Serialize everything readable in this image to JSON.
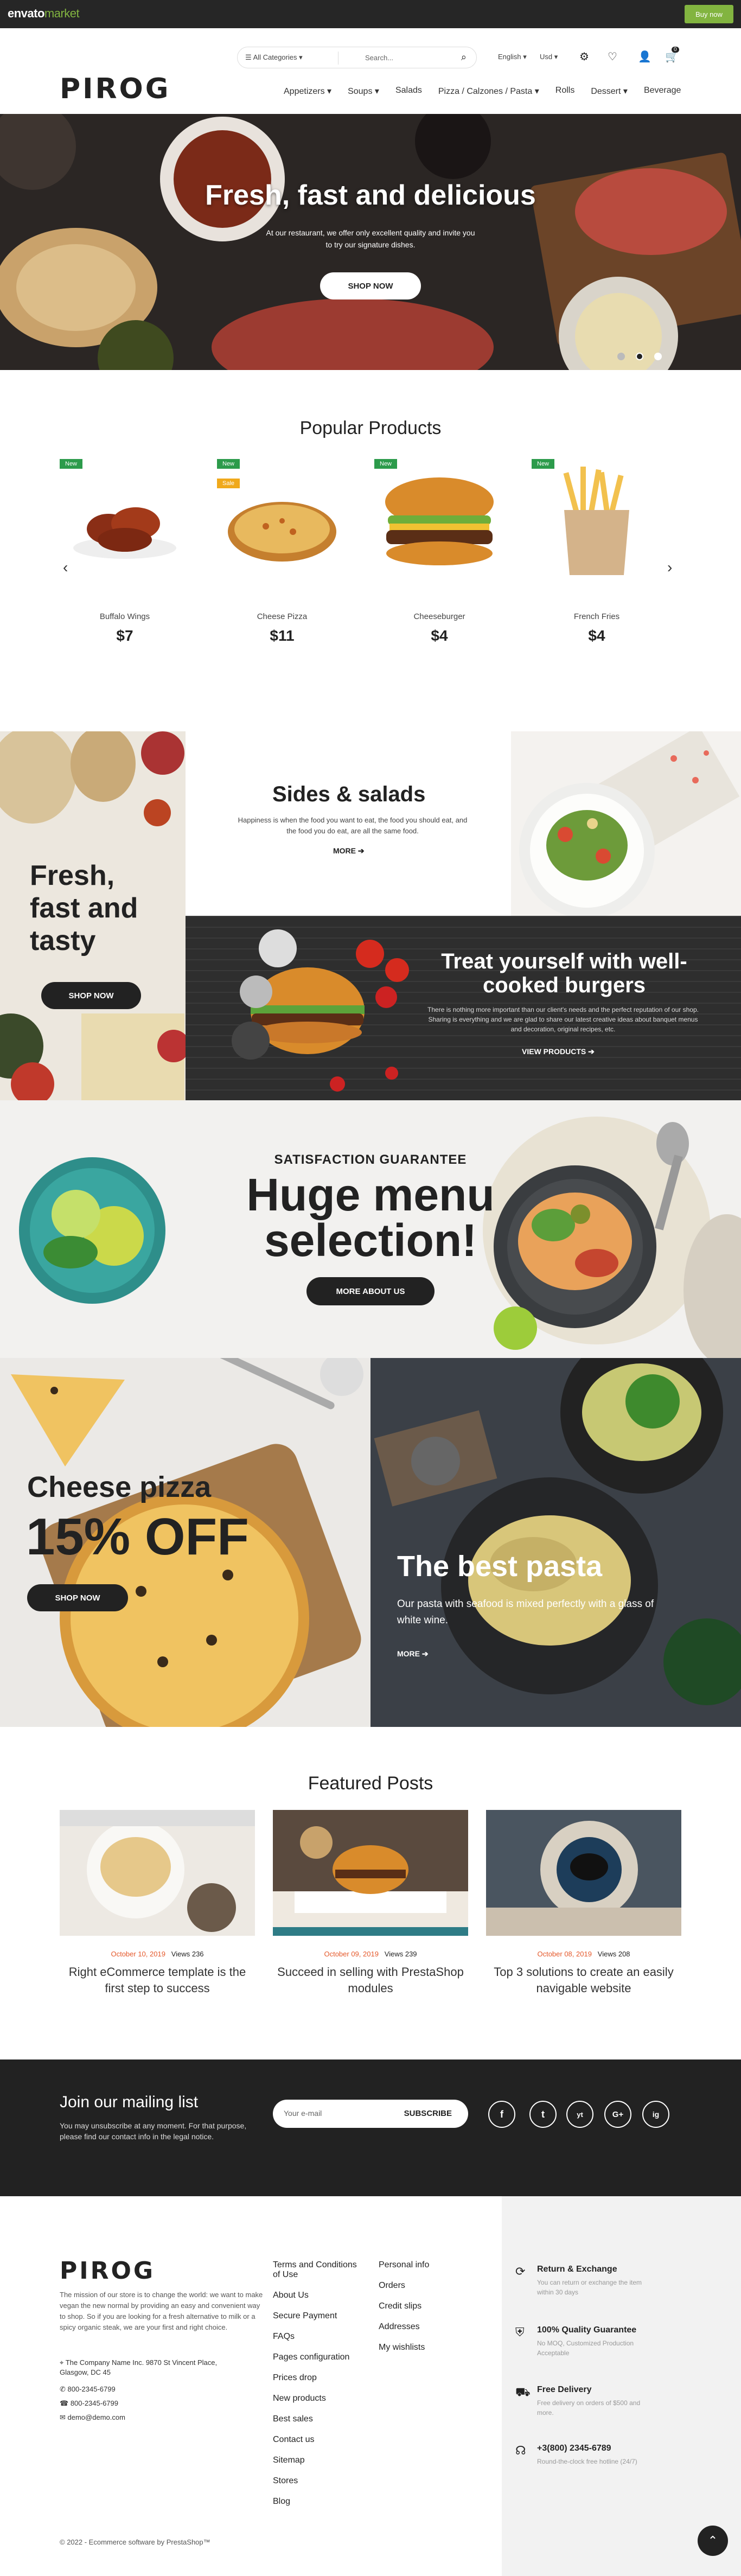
{
  "envato": {
    "logo": "envato",
    "logo_suffix": "market",
    "buy": "Buy now"
  },
  "header": {
    "logo": "PIROG",
    "categories": "All Categories",
    "search_placeholder": "Search...",
    "language": "English",
    "currency": "Usd",
    "cart_count": "0",
    "menu": [
      "Appetizers",
      "Soups",
      "Salads",
      "Pizza / Calzones / Pasta",
      "Rolls",
      "Dessert",
      "Beverage"
    ]
  },
  "hero": {
    "title": "Fresh, fast and delicious",
    "subtitle": "At our restaurant, we offer only excellent quality and invite you to try our signature dishes.",
    "button": "SHOP NOW"
  },
  "popular": {
    "title": "Popular Products",
    "items": [
      {
        "name": "Buffalo Wings",
        "price": "$7",
        "flag": "New",
        "flag2": ""
      },
      {
        "name": "Cheese Pizza",
        "price": "$11",
        "flag": "New",
        "flag2": "Sale"
      },
      {
        "name": "Cheeseburger",
        "price": "$4",
        "flag": "New",
        "flag2": ""
      },
      {
        "name": "French Fries",
        "price": "$4",
        "flag": "New",
        "flag2": ""
      }
    ]
  },
  "banners": {
    "fresh": {
      "title": "Fresh, fast and tasty",
      "button": "SHOP NOW"
    },
    "sides": {
      "title": "Sides & salads",
      "text": "Happiness is when the food you want to eat, the food you should eat, and the food you do eat, are all the same food.",
      "link": "MORE"
    },
    "burgers": {
      "title": "Treat yourself with well-cooked burgers",
      "text": "There is nothing more important than our client's needs and the perfect reputation of our shop. Sharing is everything and we are glad to share our latest creative ideas about banquet menus and decoration, original recipes, etc.",
      "link": "VIEW PRODUCTS"
    },
    "huge": {
      "eyebrow": "SATISFACTION GUARANTEE",
      "title": "Huge menu selection!",
      "button": "MORE ABOUT US"
    },
    "pizza": {
      "title": "Cheese pizza",
      "offer": "15% OFF",
      "button": "SHOP NOW"
    },
    "pasta": {
      "title": "The best pasta",
      "text": "Our pasta with seafood is mixed perfectly with a glass of white wine.",
      "link": "MORE"
    }
  },
  "posts": {
    "title": "Featured Posts",
    "items": [
      {
        "date": "October 10, 2019",
        "views": "Views 236",
        "title": "Right eCommerce template is the first step to success"
      },
      {
        "date": "October 09, 2019",
        "views": "Views 239",
        "title": "Succeed in selling with PrestaShop modules"
      },
      {
        "date": "October 08, 2019",
        "views": "Views 208",
        "title": "Top 3 solutions to create an easily navigable website"
      }
    ]
  },
  "newsletter": {
    "title": "Join our mailing list",
    "text": "You may unsubscribe at any moment. For that purpose, please find our contact info in the legal notice.",
    "placeholder": "Your e-mail",
    "button": "SUBSCRIBE"
  },
  "social": [
    "f",
    "t",
    "yt",
    "G+",
    "ig"
  ],
  "footer": {
    "logo": "PIROG",
    "about": "The mission of our store is to change the world: we want to make vegan the new normal by providing an easy and convenient way to shop. So if you are looking for a fresh alternative to milk or a spicy organic steak, we are your first and right choice.",
    "address": "The Company Name Inc. 9870 St Vincent Place, Glasgow, DC 45",
    "phone1": "800-2345-6799",
    "phone2": "800-2345-6799",
    "email": "demo@demo.com",
    "col1": [
      "Terms and Conditions of Use",
      "About Us",
      "Secure Payment",
      "FAQs",
      "Pages configuration",
      "Prices drop",
      "New products",
      "Best sales",
      "Contact us",
      "Sitemap",
      "Stores",
      "Blog"
    ],
    "col2": [
      "Personal info",
      "Orders",
      "Credit slips",
      "Addresses",
      "My wishlists"
    ],
    "services": [
      {
        "title": "Return & Exchange",
        "text": "You can return or exchange the item within 30 days"
      },
      {
        "title": "100% Quality Guarantee",
        "text": "No MOQ, Customized Production Acceptable"
      },
      {
        "title": "Free Delivery",
        "text": "Free delivery on orders of $500 and more."
      },
      {
        "title": "+3(800) 2345-6789",
        "text": "Round-the-clock free hotline (24/7)"
      }
    ],
    "copyright": "© 2022 - Ecommerce software by PrestaShop™"
  }
}
